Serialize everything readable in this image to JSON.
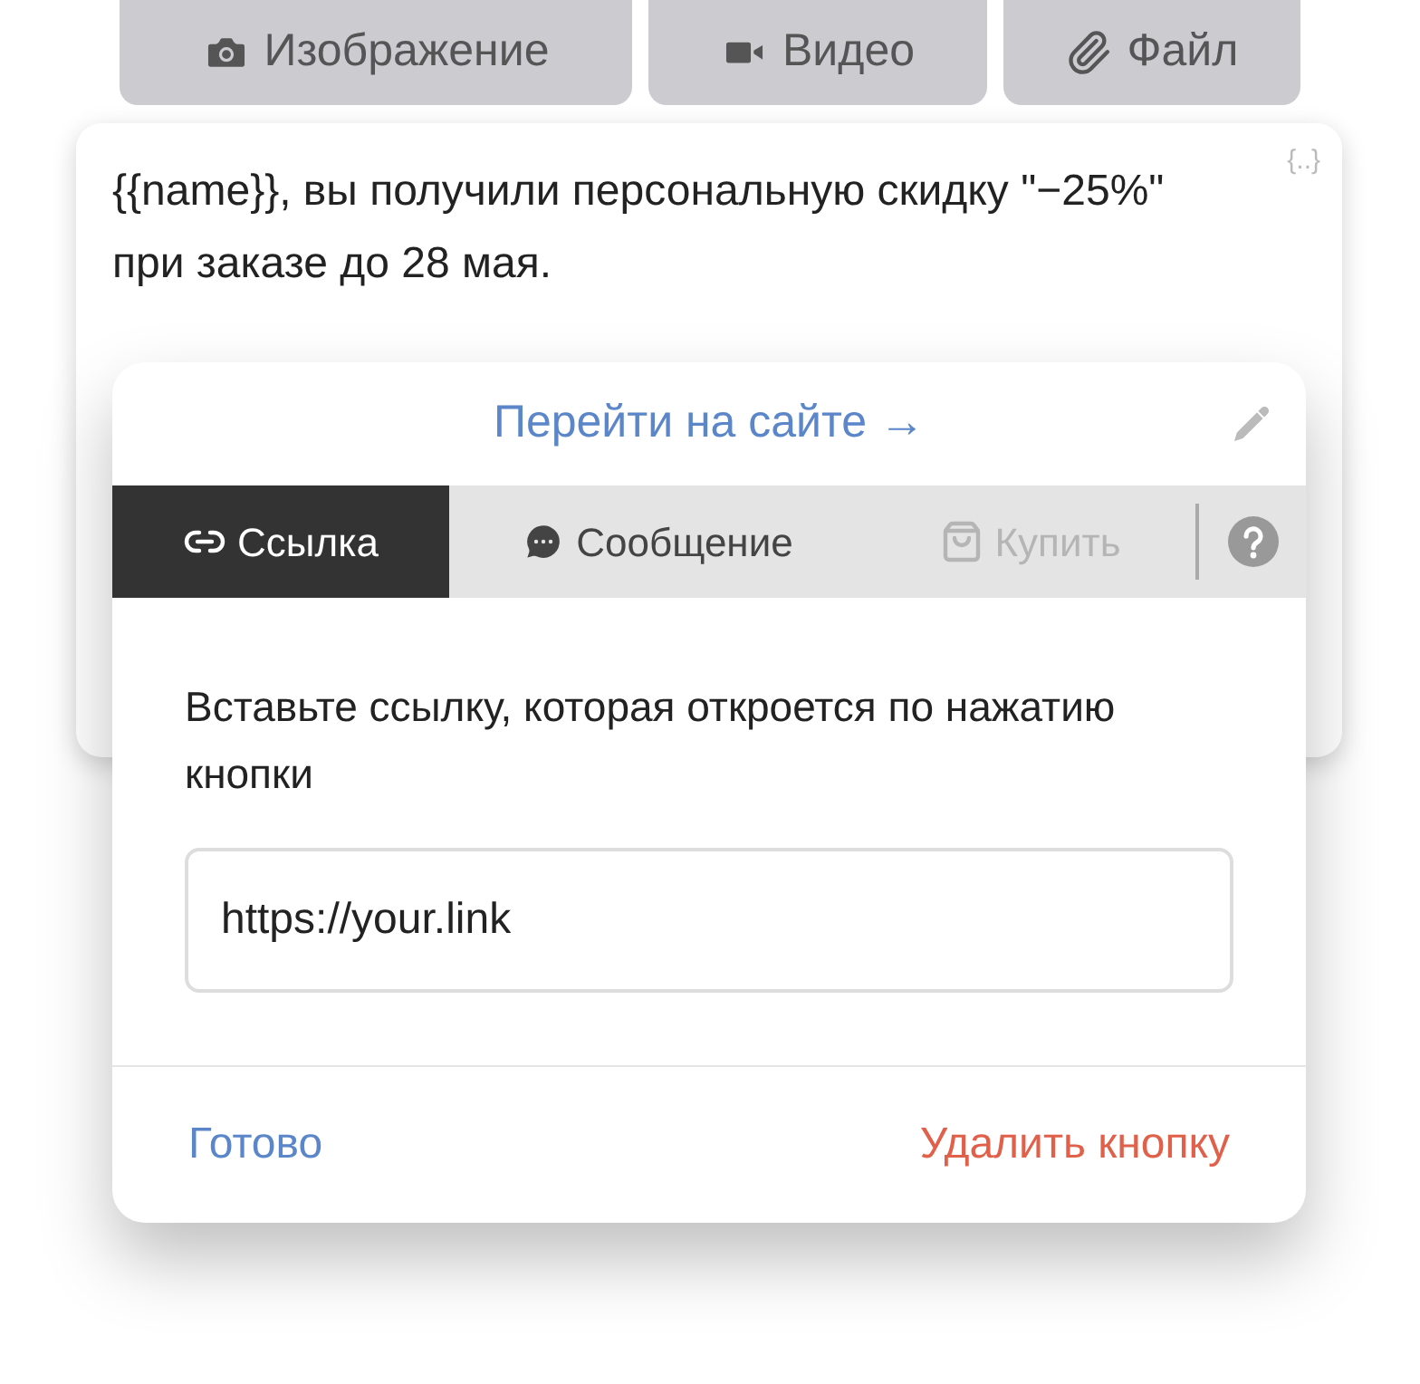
{
  "attach_buttons": [
    {
      "kind": "image",
      "label": "Изображение"
    },
    {
      "kind": "video",
      "label": "Видео"
    },
    {
      "kind": "file",
      "label": "Файл"
    }
  ],
  "message": {
    "text": "{{name}}, вы получили персональную скидку \"−25%\" при заказе до 28 мая.",
    "variables_button": "{..}"
  },
  "button_editor": {
    "title": "Перейти на сайте →",
    "tabs": [
      {
        "kind": "link",
        "label": "Ссылка",
        "selected": true,
        "disabled": false
      },
      {
        "kind": "message",
        "label": "Сообщение",
        "selected": false,
        "disabled": false
      },
      {
        "kind": "buy",
        "label": "Купить",
        "selected": false,
        "disabled": true
      }
    ],
    "instruction": "Вставьте ссылку, которая откроется по нажатию кнопки",
    "url_field": {
      "value": "https://your.link"
    },
    "done": "Готово",
    "delete": "Удалить кнопку"
  }
}
